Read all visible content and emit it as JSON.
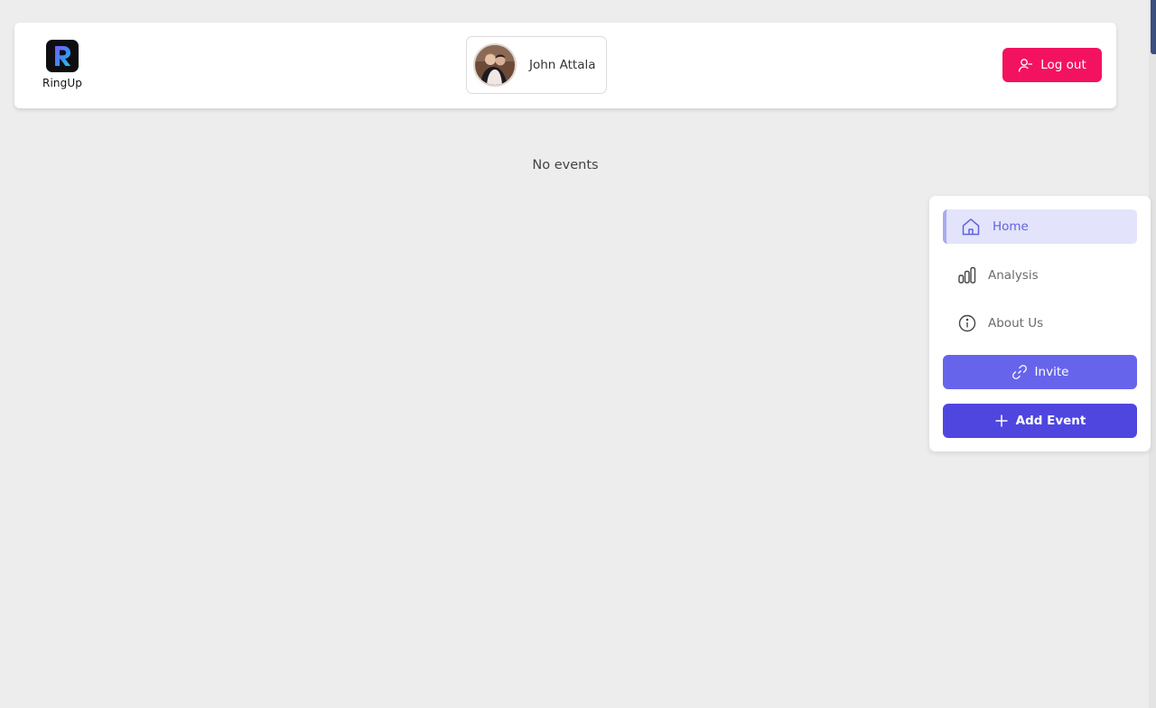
{
  "header": {
    "logo_text": "RingUp",
    "user_name": "John Attala",
    "logout_label": "Log out"
  },
  "main": {
    "empty_message": "No events"
  },
  "sidebar": {
    "items": [
      {
        "label": "Home",
        "icon": "home-icon",
        "active": true
      },
      {
        "label": "Analysis",
        "icon": "bar-chart-icon",
        "active": false
      },
      {
        "label": "About Us",
        "icon": "info-icon",
        "active": false
      }
    ],
    "invite_label": "Invite",
    "add_event_label": "Add Event"
  },
  "colors": {
    "background": "#ededed",
    "logout": "#f31260",
    "active_bg": "#e3e3fb",
    "active_text": "#6163df",
    "invite": "#6764ec",
    "add_event": "#4f46e0"
  }
}
